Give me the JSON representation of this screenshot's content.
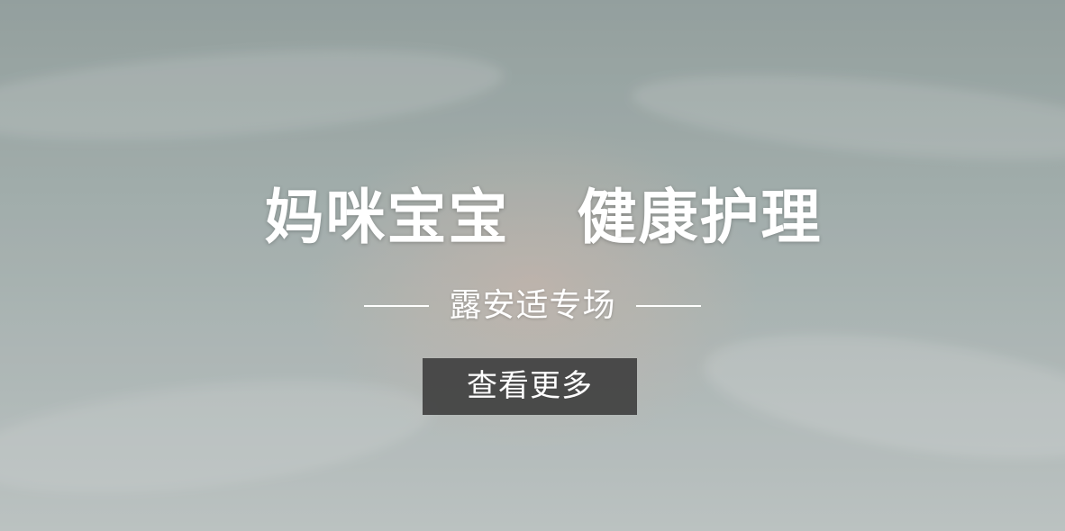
{
  "banner": {
    "headline": "妈咪宝宝   健康护理",
    "subheadline": "露安适专场",
    "cta_label": "查看更多"
  },
  "colors": {
    "text": "#ffffff",
    "button_background": "#3a3a3a"
  }
}
